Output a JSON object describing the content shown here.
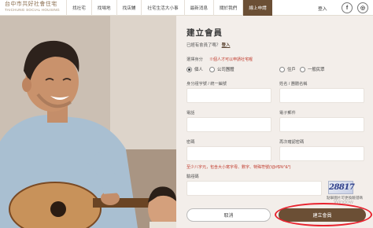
{
  "header": {
    "logo_zh": "台中市共好社會住宅",
    "logo_en": "TAICHUNG SOCIAL HOUSING",
    "nav": [
      {
        "label": "找社宅",
        "name": "nav-find-housing",
        "active": false
      },
      {
        "label": "找場地",
        "name": "nav-find-venue",
        "active": false
      },
      {
        "label": "找店鋪",
        "name": "nav-find-shop",
        "active": false
      },
      {
        "label": "社宅生活大小事",
        "name": "nav-housing-life",
        "active": false
      },
      {
        "label": "最新消息",
        "name": "nav-news",
        "active": false
      },
      {
        "label": "關於我們",
        "name": "nav-about",
        "active": false
      },
      {
        "label": "線上申請",
        "name": "nav-online-apply",
        "active": true
      }
    ],
    "login": "登入",
    "social": [
      "f",
      "◎"
    ]
  },
  "form": {
    "title": "建立會員",
    "has_account": "已經有會員了嗎？",
    "login_link": "登入",
    "identity_label": "選擇身分",
    "identity_hint": "個人才可以申請社宅喔",
    "options": [
      {
        "label": "個人",
        "checked": true
      },
      {
        "label": "公司團體",
        "checked": false
      },
      {
        "label": "住戶",
        "checked": false
      },
      {
        "label": "一般民眾",
        "checked": false
      }
    ],
    "id_label": "身分證字號 / 統一編號",
    "name_label": "姓名 / 團體名稱",
    "phone_label": "電話",
    "email_label": "電子郵件",
    "password_label": "密碼",
    "confirm_label": "再次確認密碼",
    "password_rule": "至少八字元，包含大小寫字母、數字、特殊符號(!@#$%^&*)",
    "captcha_label": "驗證碼",
    "captcha_text": "28817",
    "captcha_note": "點擊圖片可更換驗證碼",
    "cancel": "取消",
    "submit": "建立會員"
  },
  "watermark": "Window"
}
